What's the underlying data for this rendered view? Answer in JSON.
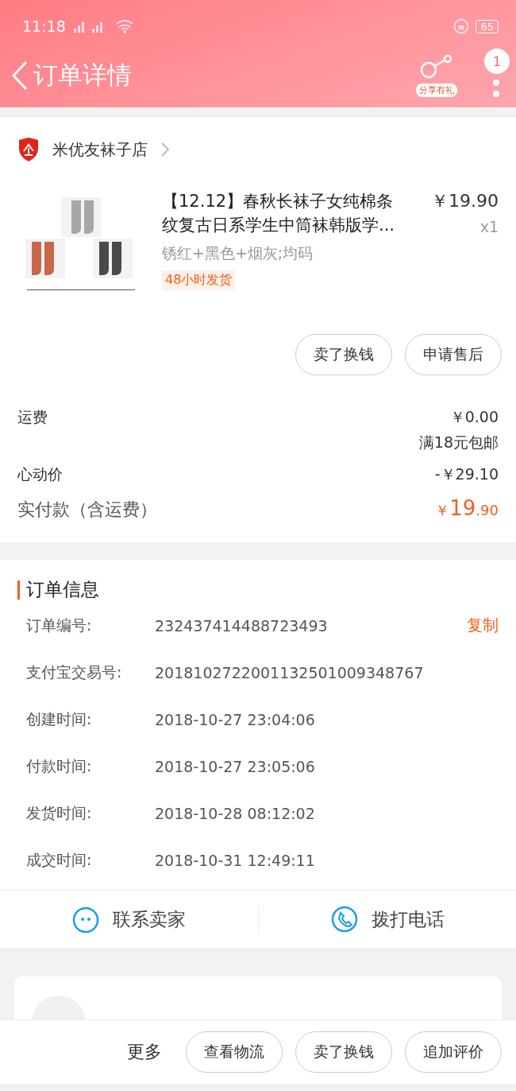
{
  "status_bar": {
    "time": "11:18",
    "battery": "65"
  },
  "header": {
    "title": "订单详情",
    "share_label": "分享有礼",
    "badge": "1"
  },
  "shop": {
    "name": "米优友袜子店"
  },
  "item": {
    "title": "【12.12】春秋长袜子女纯棉条纹复古日系学生中筒袜韩版学...",
    "price": "￥19.90",
    "quantity": "x1",
    "spec": "锈红+黑色+烟灰;均码",
    "tag": "48小时发货"
  },
  "item_actions": [
    "卖了换钱",
    "申请售后"
  ],
  "summary": {
    "shipping": {
      "label": "运费",
      "value": "￥0.00",
      "note": "满18元包邮"
    },
    "discount": {
      "label": "心动价",
      "value": "-￥29.10"
    },
    "total": {
      "label": "实付款（含运费）",
      "currency": "￥",
      "integer": "19",
      "decimals": ".90"
    }
  },
  "order_info": {
    "title": "订单信息",
    "rows": [
      {
        "label": "订单编号:",
        "value": "232437414488723493",
        "action": "复制"
      },
      {
        "label": "支付宝交易号:",
        "value": "2018102722001132501009348767"
      },
      {
        "label": "创建时间:",
        "value": "2018-10-27 23:04:06"
      },
      {
        "label": "付款时间:",
        "value": "2018-10-27 23:05:06"
      },
      {
        "label": "发货时间:",
        "value": "2018-10-28 08:12:02"
      },
      {
        "label": "成交时间:",
        "value": "2018-10-31 12:49:11"
      }
    ]
  },
  "contact": [
    {
      "kind": "chat",
      "label": "联系卖家"
    },
    {
      "kind": "phone",
      "label": "拨打电话"
    }
  ],
  "bottom_bar": {
    "more": "更多",
    "buttons": [
      "查看物流",
      "卖了换钱",
      "追加评价"
    ]
  }
}
